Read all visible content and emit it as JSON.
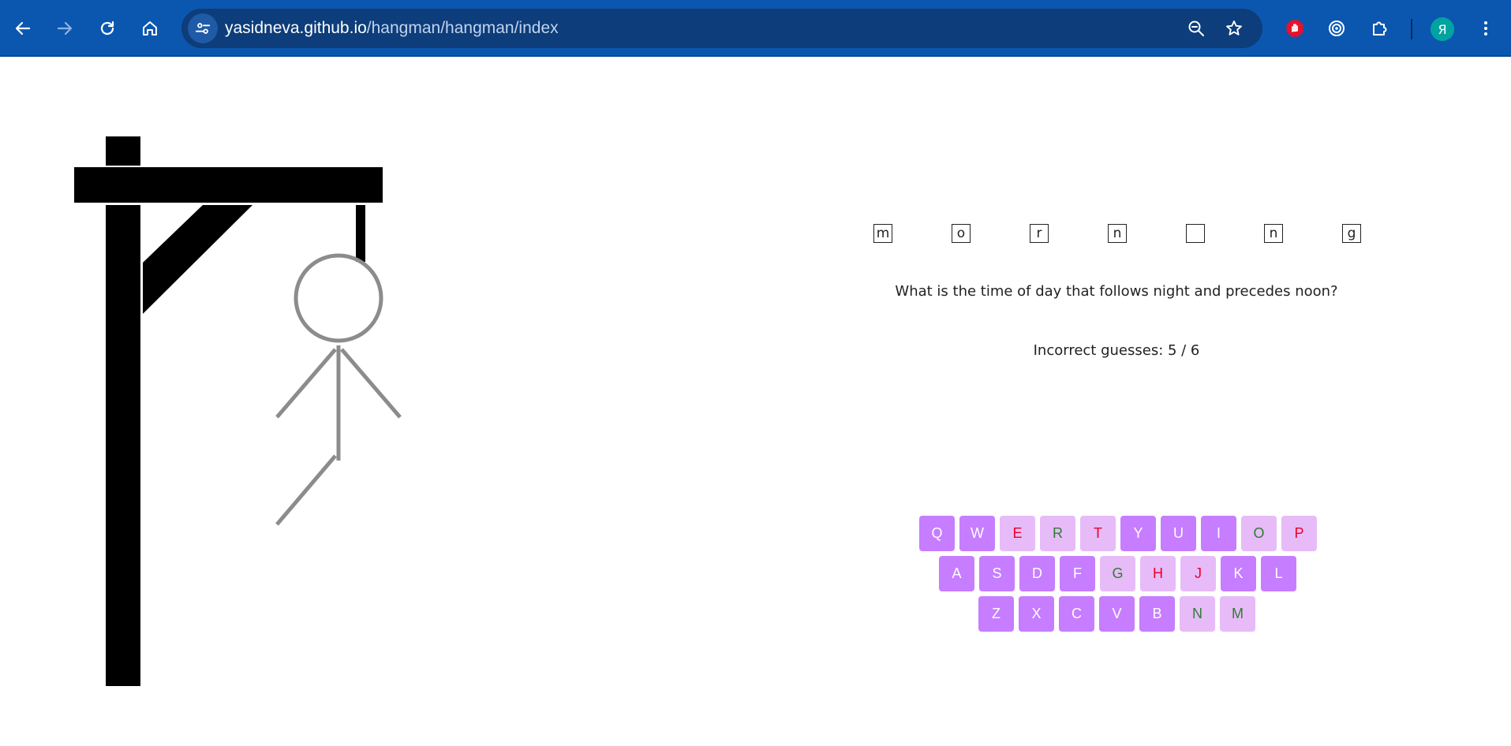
{
  "browser": {
    "url_host": "yasidneva.github.io",
    "url_path": "/hangman/hangman/index",
    "profile_initial": "Я",
    "colors": {
      "toolbar": "#0b57b0",
      "omnibox": "#0d3d7a",
      "avatar": "#00a3a0",
      "extension_red": "#e8102a"
    }
  },
  "game": {
    "word_letters": [
      "m",
      "o",
      "r",
      "n",
      "",
      "n",
      "g"
    ],
    "hint": "What is the time of day that follows night and precedes noon?",
    "incorrect_guesses_text": "Incorrect guesses: 5 / 6",
    "incorrect_guesses": 5,
    "max_guesses": 6,
    "hangman_parts_drawn": [
      "head",
      "body",
      "left-arm",
      "right-arm",
      "left-leg"
    ],
    "colors": {
      "key_unused": "#c77dff",
      "key_used": "#e7bbf8",
      "key_correct_text": "#2e7d32",
      "key_wrong_text": "#e8002a",
      "gallows": "#000000",
      "figure": "#8c8c8c"
    }
  },
  "keyboard": {
    "rows": [
      [
        {
          "letter": "Q",
          "state": "unused"
        },
        {
          "letter": "W",
          "state": "unused"
        },
        {
          "letter": "E",
          "state": "wrong"
        },
        {
          "letter": "R",
          "state": "correct"
        },
        {
          "letter": "T",
          "state": "wrong"
        },
        {
          "letter": "Y",
          "state": "unused"
        },
        {
          "letter": "U",
          "state": "unused"
        },
        {
          "letter": "I",
          "state": "unused"
        },
        {
          "letter": "O",
          "state": "correct"
        },
        {
          "letter": "P",
          "state": "wrong"
        }
      ],
      [
        {
          "letter": "A",
          "state": "unused"
        },
        {
          "letter": "S",
          "state": "unused"
        },
        {
          "letter": "D",
          "state": "unused"
        },
        {
          "letter": "F",
          "state": "unused"
        },
        {
          "letter": "G",
          "state": "correct"
        },
        {
          "letter": "H",
          "state": "wrong"
        },
        {
          "letter": "J",
          "state": "wrong"
        },
        {
          "letter": "K",
          "state": "unused"
        },
        {
          "letter": "L",
          "state": "unused"
        }
      ],
      [
        {
          "letter": "Z",
          "state": "unused"
        },
        {
          "letter": "X",
          "state": "unused"
        },
        {
          "letter": "C",
          "state": "unused"
        },
        {
          "letter": "V",
          "state": "unused"
        },
        {
          "letter": "B",
          "state": "unused"
        },
        {
          "letter": "N",
          "state": "correct"
        },
        {
          "letter": "M",
          "state": "correct"
        }
      ]
    ]
  }
}
